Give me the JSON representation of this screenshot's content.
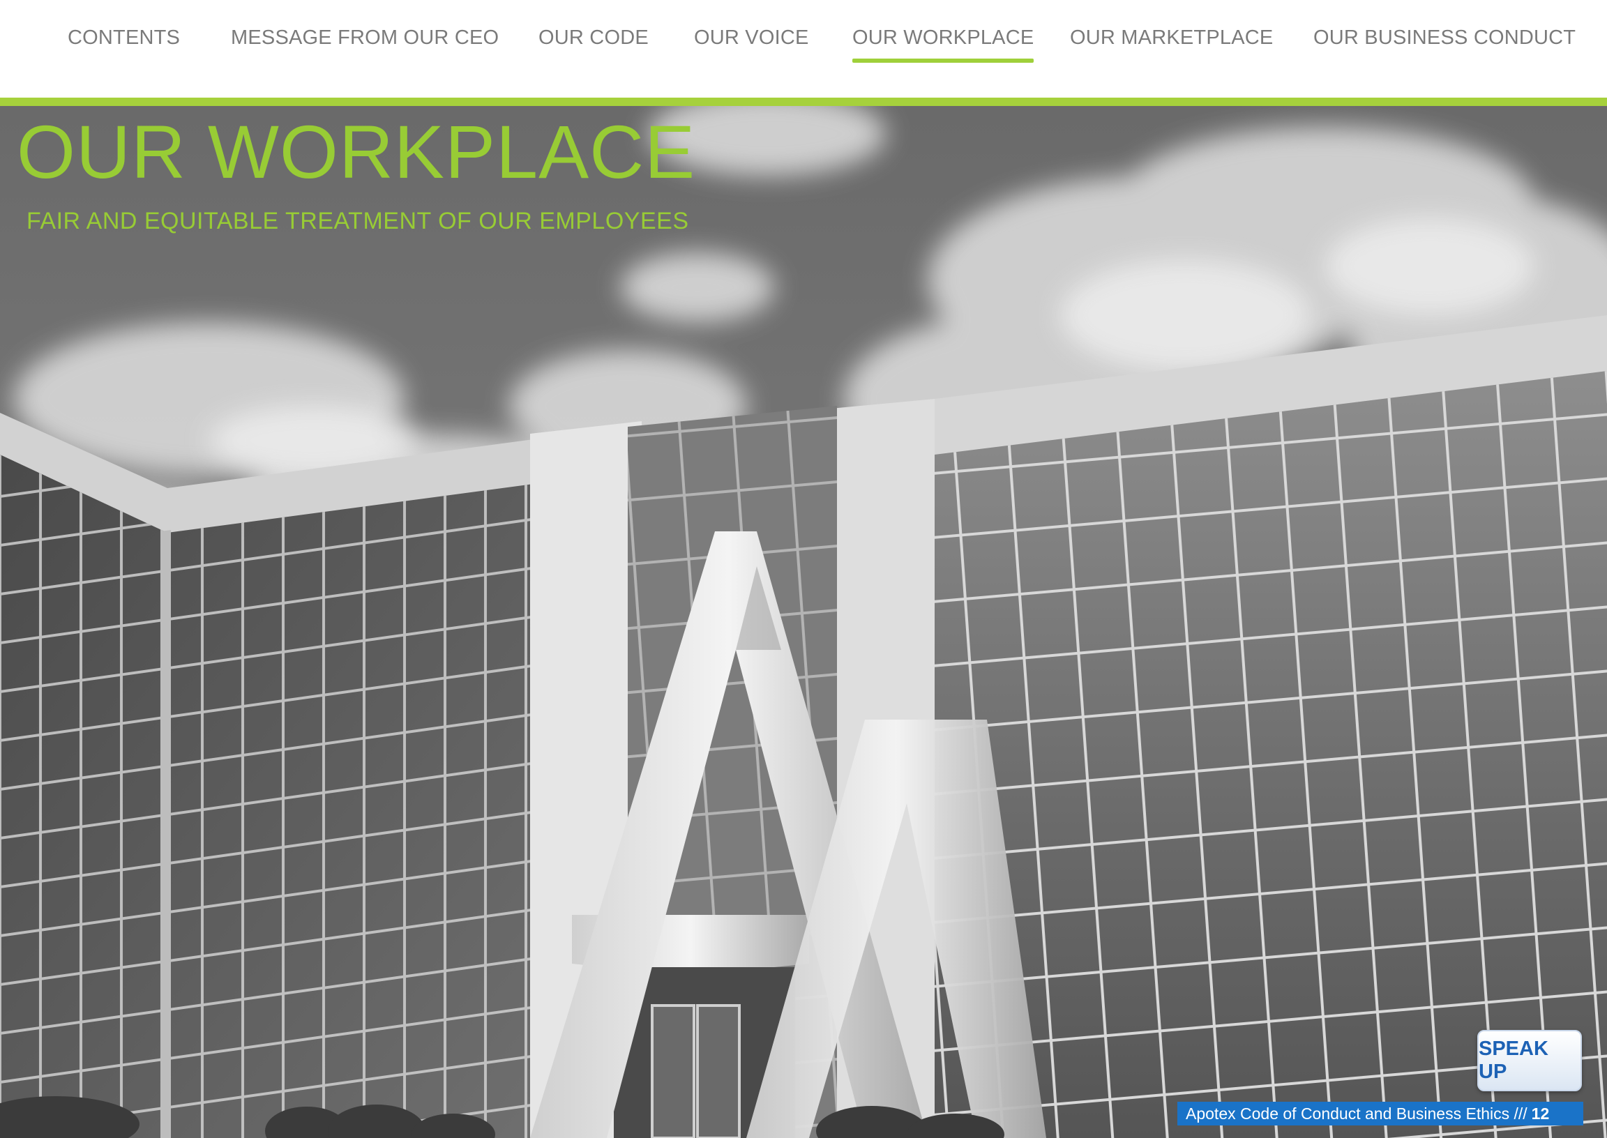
{
  "nav": {
    "items": [
      {
        "label": "CONTENTS"
      },
      {
        "label": "MESSAGE FROM OUR CEO"
      },
      {
        "label": "OUR CODE"
      },
      {
        "label": "OUR VOICE"
      },
      {
        "label": "OUR WORKPLACE",
        "active": true
      },
      {
        "label": "OUR MARKETPLACE"
      },
      {
        "label": "OUR BUSINESS CONDUCT"
      }
    ],
    "accent_color": "#a6d13c"
  },
  "header": {
    "title": "OUR WORKPLACE",
    "subtitle": "FAIR AND EQUITABLE TREATMENT OF OUR EMPLOYEES"
  },
  "speak_up": {
    "label": "SPEAK UP"
  },
  "footer": {
    "text": "Apotex Code of Conduct and Business Ethics ///",
    "page_number": "12"
  },
  "colors": {
    "title_green": "#98cc35",
    "footer_blue": "#1a73c8",
    "speak_up_text": "#1d62b5"
  }
}
